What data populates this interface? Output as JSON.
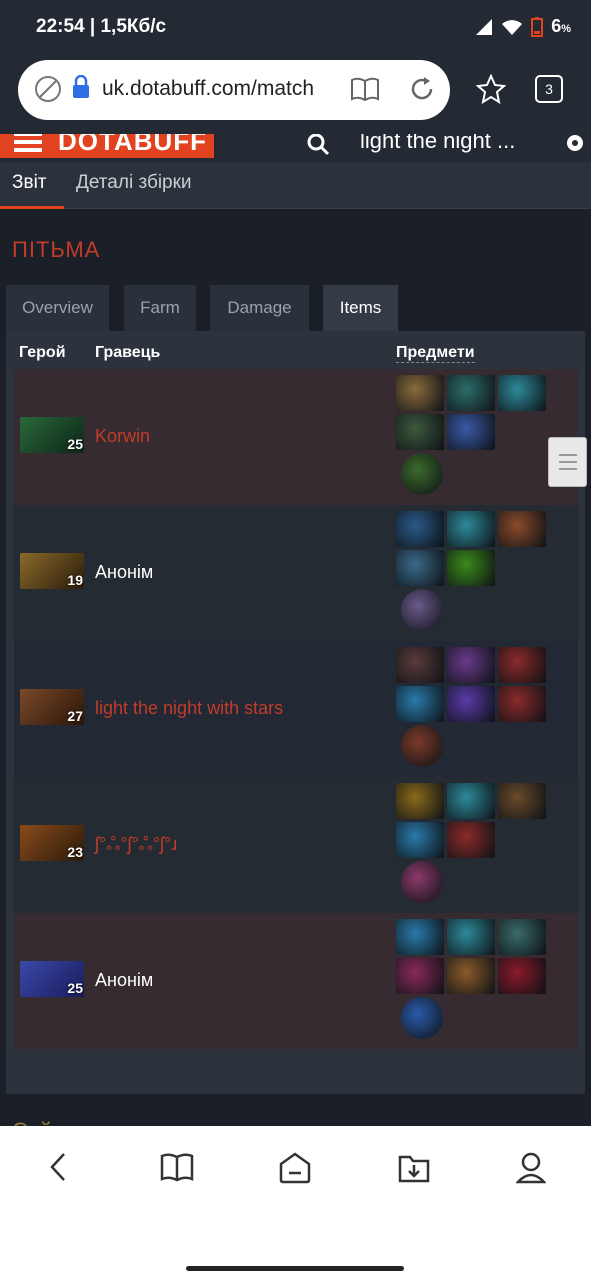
{
  "status": {
    "time_speed": "22:54 | 1,5Кб/с",
    "battery": "6",
    "battery_unit": "%"
  },
  "browser": {
    "url": "uk.dotabuff.com/match",
    "tab_count": "3"
  },
  "site": {
    "brand": "DOTABUFF",
    "search_query": "light the night ..."
  },
  "subnav": {
    "items": [
      {
        "label": "Звіт"
      },
      {
        "label": "Деталі збірки"
      }
    ]
  },
  "section": {
    "title": "Пітьма"
  },
  "tabs": [
    {
      "label": "Overview"
    },
    {
      "label": "Farm"
    },
    {
      "label": "Damage"
    },
    {
      "label": "Items"
    }
  ],
  "table": {
    "headers": {
      "hero": "Герой",
      "player": "Гравець",
      "items": "Предмети"
    }
  },
  "rows": [
    {
      "level": "25",
      "player": "Korwin",
      "player_color": "#c23c2a",
      "hero_colors": [
        "#2a6a3a",
        "#0d2418"
      ],
      "items": [
        "#8a6b3c",
        "#2d6d6a",
        "#2d8a9a",
        "#3d5a3d",
        "#3a5aa8"
      ],
      "neutral": "#3a6a2a"
    },
    {
      "level": "19",
      "player": "Анонім",
      "player_color": "#ffffff",
      "hero_colors": [
        "#8a6a2a",
        "#2a1a0a"
      ],
      "items": [
        "#2a5a8a",
        "#2d8a9a",
        "#8a4a2a",
        "#3a6a8a",
        "#3a8a1a"
      ],
      "neutral": "#6a5a8a"
    },
    {
      "level": "27",
      "player": "light the night with stars",
      "player_color": "#c23c2a",
      "hero_colors": [
        "#7a4a2a",
        "#2a1408"
      ],
      "items": [
        "#5a3a3a",
        "#6a3a8a",
        "#8a2a2a",
        "#2a7aaa",
        "#5a3aaa",
        "#8a2a2a"
      ],
      "neutral": "#7a3a2a"
    },
    {
      "level": "23",
      "player": "ʃ°ஃ°ʃ°ஃ°ʃ°ɹ",
      "player_color": "#c23c2a",
      "hero_colors": [
        "#8a4a1a",
        "#2a1a0a"
      ],
      "items": [
        "#8a6a1a",
        "#2d8a9a",
        "#6a4a2a",
        "#2a7aaa",
        "#8a2a2a"
      ],
      "neutral": "#8a3a6a"
    },
    {
      "level": "25",
      "player": "Анонім",
      "player_color": "#ffffff",
      "hero_colors": [
        "#3a4aaa",
        "#1a1a5a"
      ],
      "items": [
        "#2a7aaa",
        "#2d8a9a",
        "#3a6a6a",
        "#8a2a5a",
        "#8a5a2a",
        "#8a1a2a"
      ],
      "neutral": "#2a5aaa"
    }
  ],
  "next_section": {
    "title": "Сяйво"
  },
  "colors": {
    "accent": "#e1421f",
    "dire": "#c23c2a",
    "bg": "#1b2028",
    "panel": "#2d333c"
  }
}
